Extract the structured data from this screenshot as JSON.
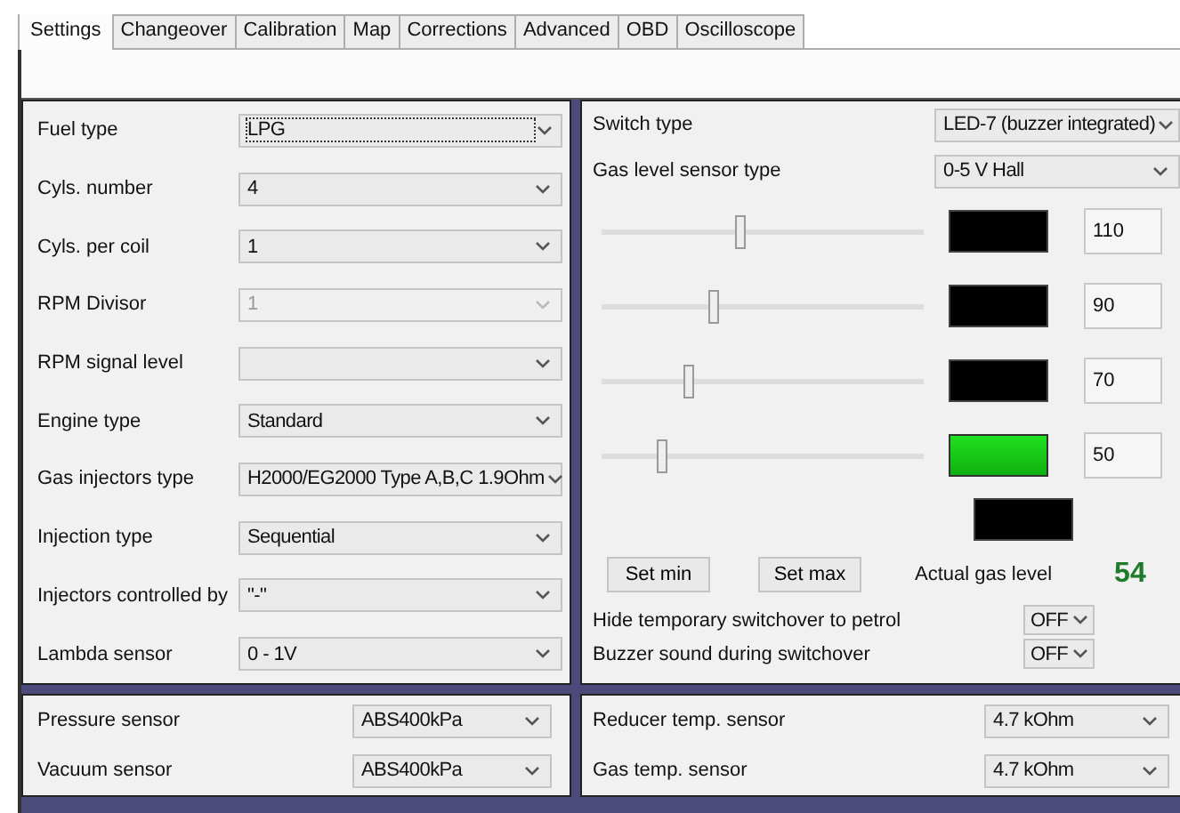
{
  "tabs": [
    {
      "label": "Settings",
      "selected": true
    },
    {
      "label": "Changeover",
      "selected": false
    },
    {
      "label": "Calibration",
      "selected": false
    },
    {
      "label": "Map",
      "selected": false
    },
    {
      "label": "Corrections",
      "selected": false
    },
    {
      "label": "Advanced",
      "selected": false
    },
    {
      "label": "OBD",
      "selected": false
    },
    {
      "label": "Oscilloscope",
      "selected": false
    }
  ],
  "engine_panel": {
    "rows": [
      {
        "label": "Fuel type",
        "value": "LPG",
        "disabled": false,
        "focused": true
      },
      {
        "label": "Cyls. number",
        "value": "4",
        "disabled": false,
        "focused": false
      },
      {
        "label": "Cyls. per coil",
        "value": "1",
        "disabled": false,
        "focused": false
      },
      {
        "label": "RPM Divisor",
        "value": "1",
        "disabled": true,
        "focused": false
      },
      {
        "label": "RPM signal level",
        "disabled": false,
        "focused": false
      },
      {
        "label": "Engine type",
        "value": "Standard",
        "disabled": false,
        "focused": false
      },
      {
        "label": "Gas injectors type",
        "value": "H2000/EG2000 Type A,B,C 1.9Ohm",
        "disabled": false,
        "focused": false
      },
      {
        "label": "Injection type",
        "value": "Sequential",
        "disabled": false,
        "focused": false
      },
      {
        "label": "Injectors controlled by",
        "value": "\"-\"",
        "disabled": false,
        "focused": false
      },
      {
        "label": "Lambda sensor",
        "value": "0 - 1V",
        "disabled": false,
        "focused": false
      }
    ]
  },
  "level_panel": {
    "selects": [
      {
        "label": "Switch type",
        "value": "LED-7 (buzzer integrated)"
      },
      {
        "label": "Gas level sensor type",
        "value": "0-5 V Hall"
      }
    ],
    "sliders": [
      {
        "level": 0.43,
        "lit": false,
        "reading": "110"
      },
      {
        "level": 0.35,
        "lit": false,
        "reading": "90"
      },
      {
        "level": 0.27,
        "lit": false,
        "reading": "70"
      },
      {
        "level": 0.19,
        "lit": true,
        "reading": "50"
      }
    ],
    "extra_indicator": {
      "lit": false
    },
    "buttons": [
      "Set min",
      "Set max"
    ],
    "actual": {
      "label": "Actual gas level",
      "value": "54"
    },
    "toggles": [
      {
        "label": "Hide temporary switchover to petrol",
        "value": "OFF"
      },
      {
        "label": "Buzzer sound during switchover",
        "value": "OFF"
      }
    ]
  },
  "sensor_panels": [
    {
      "rows": [
        {
          "label": "Pressure sensor",
          "value": "ABS400kPa"
        },
        {
          "label": "Vacuum sensor",
          "value": "ABS400kPa"
        }
      ]
    },
    {
      "rows": [
        {
          "label": "Reducer temp. sensor",
          "value": "4.7 kOhm"
        },
        {
          "label": "Gas temp. sensor",
          "value": "4.7 kOhm"
        }
      ]
    }
  ]
}
